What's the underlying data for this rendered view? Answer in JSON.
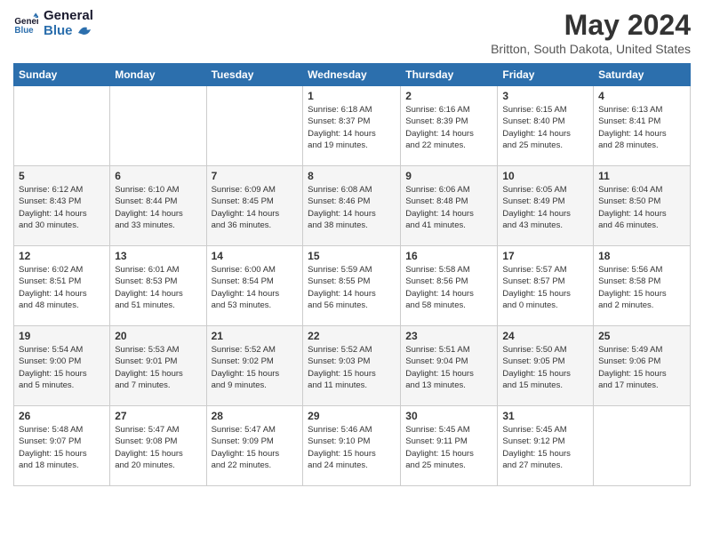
{
  "app": {
    "logo_line1": "General",
    "logo_line2": "Blue"
  },
  "header": {
    "month_year": "May 2024",
    "location": "Britton, South Dakota, United States"
  },
  "days_of_week": [
    "Sunday",
    "Monday",
    "Tuesday",
    "Wednesday",
    "Thursday",
    "Friday",
    "Saturday"
  ],
  "weeks": [
    [
      {
        "day": "",
        "info": ""
      },
      {
        "day": "",
        "info": ""
      },
      {
        "day": "",
        "info": ""
      },
      {
        "day": "1",
        "info": "Sunrise: 6:18 AM\nSunset: 8:37 PM\nDaylight: 14 hours\nand 19 minutes."
      },
      {
        "day": "2",
        "info": "Sunrise: 6:16 AM\nSunset: 8:39 PM\nDaylight: 14 hours\nand 22 minutes."
      },
      {
        "day": "3",
        "info": "Sunrise: 6:15 AM\nSunset: 8:40 PM\nDaylight: 14 hours\nand 25 minutes."
      },
      {
        "day": "4",
        "info": "Sunrise: 6:13 AM\nSunset: 8:41 PM\nDaylight: 14 hours\nand 28 minutes."
      }
    ],
    [
      {
        "day": "5",
        "info": "Sunrise: 6:12 AM\nSunset: 8:43 PM\nDaylight: 14 hours\nand 30 minutes."
      },
      {
        "day": "6",
        "info": "Sunrise: 6:10 AM\nSunset: 8:44 PM\nDaylight: 14 hours\nand 33 minutes."
      },
      {
        "day": "7",
        "info": "Sunrise: 6:09 AM\nSunset: 8:45 PM\nDaylight: 14 hours\nand 36 minutes."
      },
      {
        "day": "8",
        "info": "Sunrise: 6:08 AM\nSunset: 8:46 PM\nDaylight: 14 hours\nand 38 minutes."
      },
      {
        "day": "9",
        "info": "Sunrise: 6:06 AM\nSunset: 8:48 PM\nDaylight: 14 hours\nand 41 minutes."
      },
      {
        "day": "10",
        "info": "Sunrise: 6:05 AM\nSunset: 8:49 PM\nDaylight: 14 hours\nand 43 minutes."
      },
      {
        "day": "11",
        "info": "Sunrise: 6:04 AM\nSunset: 8:50 PM\nDaylight: 14 hours\nand 46 minutes."
      }
    ],
    [
      {
        "day": "12",
        "info": "Sunrise: 6:02 AM\nSunset: 8:51 PM\nDaylight: 14 hours\nand 48 minutes."
      },
      {
        "day": "13",
        "info": "Sunrise: 6:01 AM\nSunset: 8:53 PM\nDaylight: 14 hours\nand 51 minutes."
      },
      {
        "day": "14",
        "info": "Sunrise: 6:00 AM\nSunset: 8:54 PM\nDaylight: 14 hours\nand 53 minutes."
      },
      {
        "day": "15",
        "info": "Sunrise: 5:59 AM\nSunset: 8:55 PM\nDaylight: 14 hours\nand 56 minutes."
      },
      {
        "day": "16",
        "info": "Sunrise: 5:58 AM\nSunset: 8:56 PM\nDaylight: 14 hours\nand 58 minutes."
      },
      {
        "day": "17",
        "info": "Sunrise: 5:57 AM\nSunset: 8:57 PM\nDaylight: 15 hours\nand 0 minutes."
      },
      {
        "day": "18",
        "info": "Sunrise: 5:56 AM\nSunset: 8:58 PM\nDaylight: 15 hours\nand 2 minutes."
      }
    ],
    [
      {
        "day": "19",
        "info": "Sunrise: 5:54 AM\nSunset: 9:00 PM\nDaylight: 15 hours\nand 5 minutes."
      },
      {
        "day": "20",
        "info": "Sunrise: 5:53 AM\nSunset: 9:01 PM\nDaylight: 15 hours\nand 7 minutes."
      },
      {
        "day": "21",
        "info": "Sunrise: 5:52 AM\nSunset: 9:02 PM\nDaylight: 15 hours\nand 9 minutes."
      },
      {
        "day": "22",
        "info": "Sunrise: 5:52 AM\nSunset: 9:03 PM\nDaylight: 15 hours\nand 11 minutes."
      },
      {
        "day": "23",
        "info": "Sunrise: 5:51 AM\nSunset: 9:04 PM\nDaylight: 15 hours\nand 13 minutes."
      },
      {
        "day": "24",
        "info": "Sunrise: 5:50 AM\nSunset: 9:05 PM\nDaylight: 15 hours\nand 15 minutes."
      },
      {
        "day": "25",
        "info": "Sunrise: 5:49 AM\nSunset: 9:06 PM\nDaylight: 15 hours\nand 17 minutes."
      }
    ],
    [
      {
        "day": "26",
        "info": "Sunrise: 5:48 AM\nSunset: 9:07 PM\nDaylight: 15 hours\nand 18 minutes."
      },
      {
        "day": "27",
        "info": "Sunrise: 5:47 AM\nSunset: 9:08 PM\nDaylight: 15 hours\nand 20 minutes."
      },
      {
        "day": "28",
        "info": "Sunrise: 5:47 AM\nSunset: 9:09 PM\nDaylight: 15 hours\nand 22 minutes."
      },
      {
        "day": "29",
        "info": "Sunrise: 5:46 AM\nSunset: 9:10 PM\nDaylight: 15 hours\nand 24 minutes."
      },
      {
        "day": "30",
        "info": "Sunrise: 5:45 AM\nSunset: 9:11 PM\nDaylight: 15 hours\nand 25 minutes."
      },
      {
        "day": "31",
        "info": "Sunrise: 5:45 AM\nSunset: 9:12 PM\nDaylight: 15 hours\nand 27 minutes."
      },
      {
        "day": "",
        "info": ""
      }
    ]
  ]
}
